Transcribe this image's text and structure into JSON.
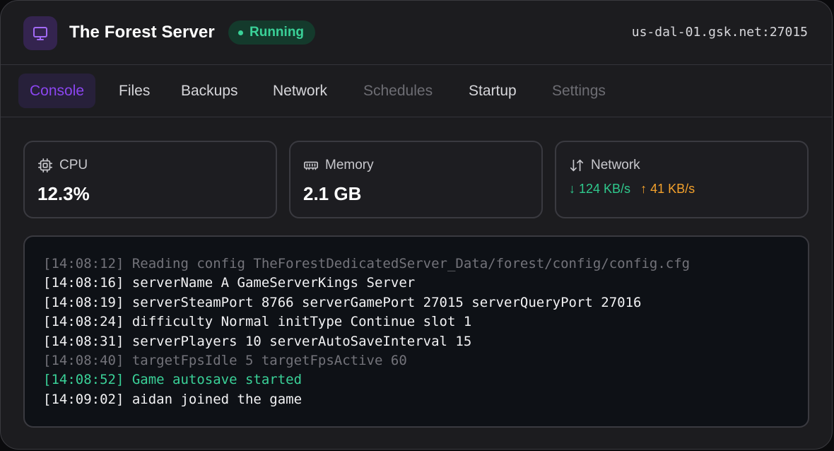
{
  "header": {
    "title": "The Forest Server",
    "status": "Running",
    "address": "us-dal-01.gsk.net:27015"
  },
  "tabs": [
    {
      "label": "Console",
      "state": "active"
    },
    {
      "label": "Files",
      "state": "normal"
    },
    {
      "label": "Backups",
      "state": "normal"
    },
    {
      "label": "Network",
      "state": "normal"
    },
    {
      "label": "Schedules",
      "state": "disabled"
    },
    {
      "label": "Startup",
      "state": "normal"
    },
    {
      "label": "Settings",
      "state": "disabled"
    }
  ],
  "stats": {
    "cpu": {
      "label": "CPU",
      "value": "12.3%",
      "icon": "cpu-chip-icon"
    },
    "memory": {
      "label": "Memory",
      "value": "2.1 GB",
      "icon": "memory-icon"
    },
    "network": {
      "label": "Network",
      "down": "124 KB/s",
      "up": "41 KB/s",
      "icon": "arrows-up-down-icon"
    }
  },
  "console": {
    "lines": [
      {
        "text": "[14:08:12] Reading config TheForestDedicatedServer_Data/forest/config/config.cfg",
        "style": "dim"
      },
      {
        "text": "[14:08:16] serverName A GameServerKings Server",
        "style": "normal"
      },
      {
        "text": "[14:08:19] serverSteamPort 8766 serverGamePort 27015 serverQueryPort 27016",
        "style": "normal"
      },
      {
        "text": "[14:08:24] difficulty Normal initType Continue slot 1",
        "style": "normal"
      },
      {
        "text": "[14:08:31] serverPlayers 10 serverAutoSaveInterval 15",
        "style": "normal"
      },
      {
        "text": "[14:08:40] targetFpsIdle 5 targetFpsActive 60",
        "style": "dim"
      },
      {
        "text": "[14:08:52] Game autosave started",
        "style": "ok"
      },
      {
        "text": "[14:09:02] aidan joined the game",
        "style": "normal"
      }
    ]
  },
  "colors": {
    "accent": "#8b45f0",
    "status_green": "#3ad198",
    "upload_orange": "#f3a12c"
  }
}
